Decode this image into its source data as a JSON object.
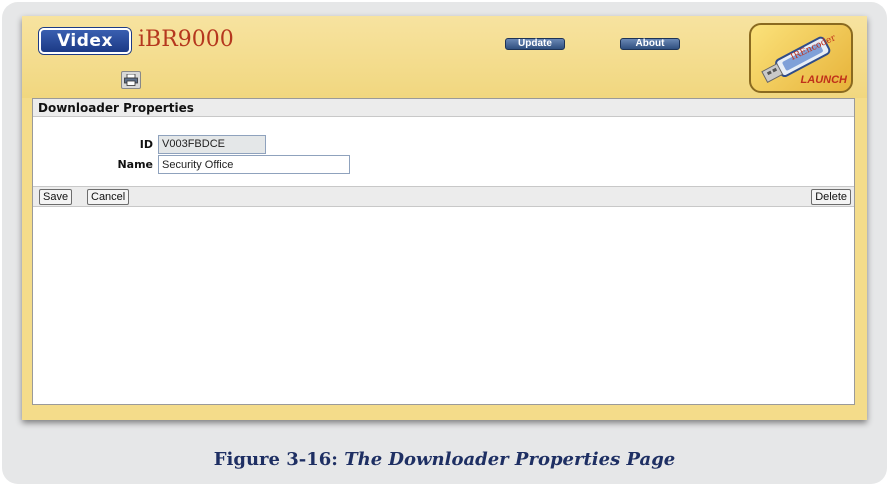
{
  "header": {
    "brand": "Videx",
    "product": "iBR9000",
    "nav": {
      "update": "Update",
      "about": "About"
    },
    "launch": {
      "brand": "IREncoder",
      "label": "LAUNCH"
    },
    "print_icon": "printer-icon"
  },
  "section": {
    "title": "Downloader Properties"
  },
  "form": {
    "id": {
      "label": "ID",
      "value": "V003FBDCE"
    },
    "name": {
      "label": "Name",
      "value": "Security Office"
    }
  },
  "toolbar": {
    "save": "Save",
    "cancel": "Cancel",
    "delete": "Delete"
  },
  "caption": {
    "number": "Figure 3-16:",
    "title": "The Downloader Properties Page"
  },
  "colors": {
    "header_bg": "#f1d77f",
    "nav_button": "#3d5f8f",
    "caption": "#1e2f63"
  }
}
